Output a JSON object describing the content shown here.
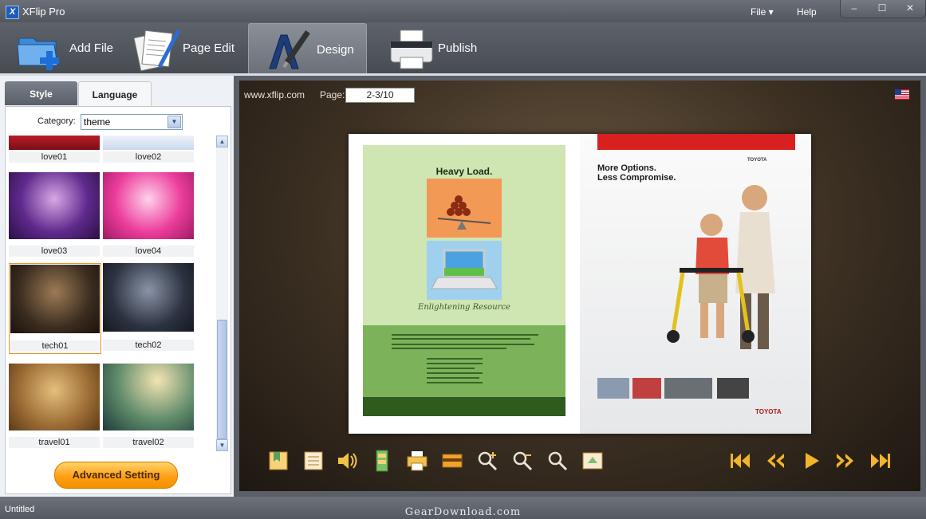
{
  "window": {
    "title": "XFlip Pro",
    "logo_letter": "X",
    "menu": {
      "file": "File ▾",
      "help": "Help"
    },
    "controls": {
      "minimize": "–",
      "maximize": "☐",
      "close": "✕"
    }
  },
  "toolbar": {
    "add_file": "Add File",
    "page_edit": "Page Edit",
    "design": "Design",
    "publish": "Publish"
  },
  "left_panel": {
    "tabs": {
      "style": "Style",
      "language": "Language"
    },
    "category_label": "Category:",
    "category_value": "theme",
    "themes": [
      "love01",
      "love02",
      "love03",
      "love04",
      "tech01",
      "tech02",
      "travel01",
      "travel02"
    ],
    "selected_theme": "tech01",
    "advanced_button": "Advanced Setting"
  },
  "preview": {
    "site": "www.xflip.com",
    "page_label": "Page:",
    "page_value": "2-3/10",
    "left_page": {
      "heading": "Heavy Load.",
      "script_text": "Enlightening Resource"
    },
    "right_page": {
      "heading_line1": "More Options.",
      "heading_line2": "Less Compromise.",
      "brand": "TOYOTA",
      "brand_tag": "TOYOTA"
    }
  },
  "status": {
    "text": "Untitled"
  },
  "watermark": "GearDownload.com",
  "colors": {
    "accent_orange": "#ffa016",
    "selection": "#e8962c",
    "dark_chrome": "#52575e"
  }
}
